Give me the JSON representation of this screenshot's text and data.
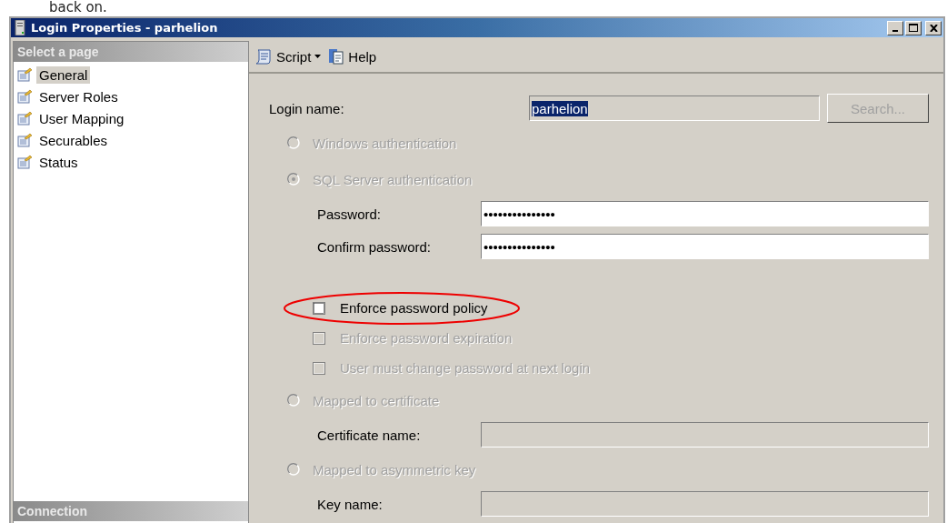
{
  "page_heading": "back on.",
  "window": {
    "title": "Login Properties - parhelion"
  },
  "sidebar": {
    "header": "Select a page",
    "items": [
      {
        "label": "General",
        "selected": true
      },
      {
        "label": "Server Roles",
        "selected": false
      },
      {
        "label": "User Mapping",
        "selected": false
      },
      {
        "label": "Securables",
        "selected": false
      },
      {
        "label": "Status",
        "selected": false
      }
    ],
    "footer_header": "Connection"
  },
  "toolbar": [
    {
      "label": "Script",
      "kind": "dropdown"
    },
    {
      "label": "Help",
      "kind": "button"
    }
  ],
  "form": [
    {
      "kind": "field",
      "label": "Login name:",
      "value": "parhelion",
      "value_selected": true,
      "disabled": true,
      "button": "Search...",
      "button_disabled": true
    },
    {
      "kind": "radio",
      "label": "Windows authentication",
      "selected": false,
      "disabled": true
    },
    {
      "kind": "radio",
      "label": "SQL Server authentication",
      "selected": true,
      "disabled": true,
      "children": [
        {
          "kind": "field",
          "label": "Password:",
          "value": "•••••••••••••••",
          "disabled": false
        },
        {
          "kind": "field",
          "label": "Confirm password:",
          "value": "•••••••••••••••",
          "disabled": false
        },
        {
          "kind": "checkbox",
          "label": "Enforce password policy",
          "checked": false,
          "disabled": false,
          "highlighted": true
        },
        {
          "kind": "checkbox",
          "label": "Enforce password expiration",
          "checked": false,
          "disabled": true,
          "highlighted": false
        },
        {
          "kind": "checkbox",
          "label": "User must change password at next login",
          "checked": false,
          "disabled": true,
          "highlighted": false
        }
      ]
    },
    {
      "kind": "radio",
      "label": "Mapped to certificate",
      "selected": false,
      "disabled": true,
      "children": [
        {
          "kind": "field",
          "label": "Certificate name:",
          "disabled": true
        }
      ]
    },
    {
      "kind": "radio",
      "label": "Mapped to asymmetric key",
      "selected": false,
      "disabled": true,
      "children": [
        {
          "kind": "field",
          "label": "Key name:",
          "disabled": true
        }
      ]
    }
  ]
}
